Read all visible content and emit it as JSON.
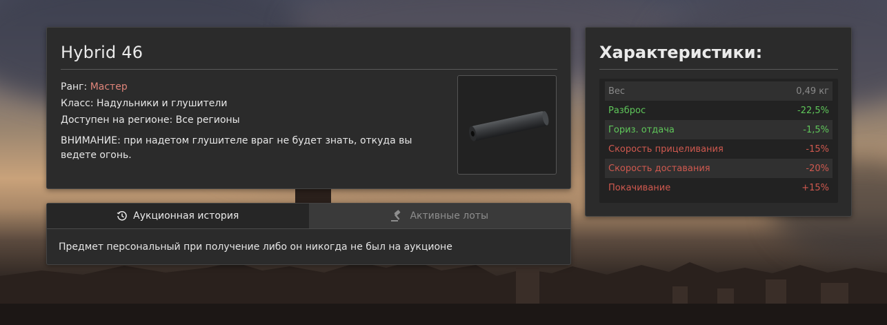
{
  "item": {
    "title": "Hybrid 46",
    "rank_label": "Ранг: ",
    "rank_value": "Мастер",
    "class_line": "Класс: Надульники и глушители",
    "region_line": "Доступен на регионе: Все регионы",
    "warning": "ВНИМАНИЕ: при надетом глушителе враг не будет знать, откуда вы ведете огонь.",
    "image_icon": "silencer-image"
  },
  "auction": {
    "tabs": [
      {
        "label": "Аукционная история",
        "icon": "history-icon",
        "active": true
      },
      {
        "label": "Активные лоты",
        "icon": "gavel-icon",
        "active": false
      }
    ],
    "message": "Предмет персональный при получение либо он никогда не был на аукционе"
  },
  "stats": {
    "title": "Характеристики:",
    "rows": [
      {
        "name": "Вес",
        "value": "0,49 кг",
        "color": "#8a8a8a"
      },
      {
        "name": "Разброс",
        "value": "-22,5%",
        "color": "#5fc75a"
      },
      {
        "name": "Гориз. отдача",
        "value": "-1,5%",
        "color": "#5fc75a"
      },
      {
        "name": "Скорость прицеливания",
        "value": "-15%",
        "color": "#d0594f"
      },
      {
        "name": "Скорость доставания",
        "value": "-20%",
        "color": "#d0594f"
      },
      {
        "name": "Покачивание",
        "value": "+15%",
        "color": "#d0594f"
      }
    ]
  },
  "colors": {
    "panel_bg": "#2b2b2b",
    "rank_accent": "#e0857a",
    "positive": "#5fc75a",
    "negative": "#d0594f",
    "neutral": "#8a8a8a"
  }
}
